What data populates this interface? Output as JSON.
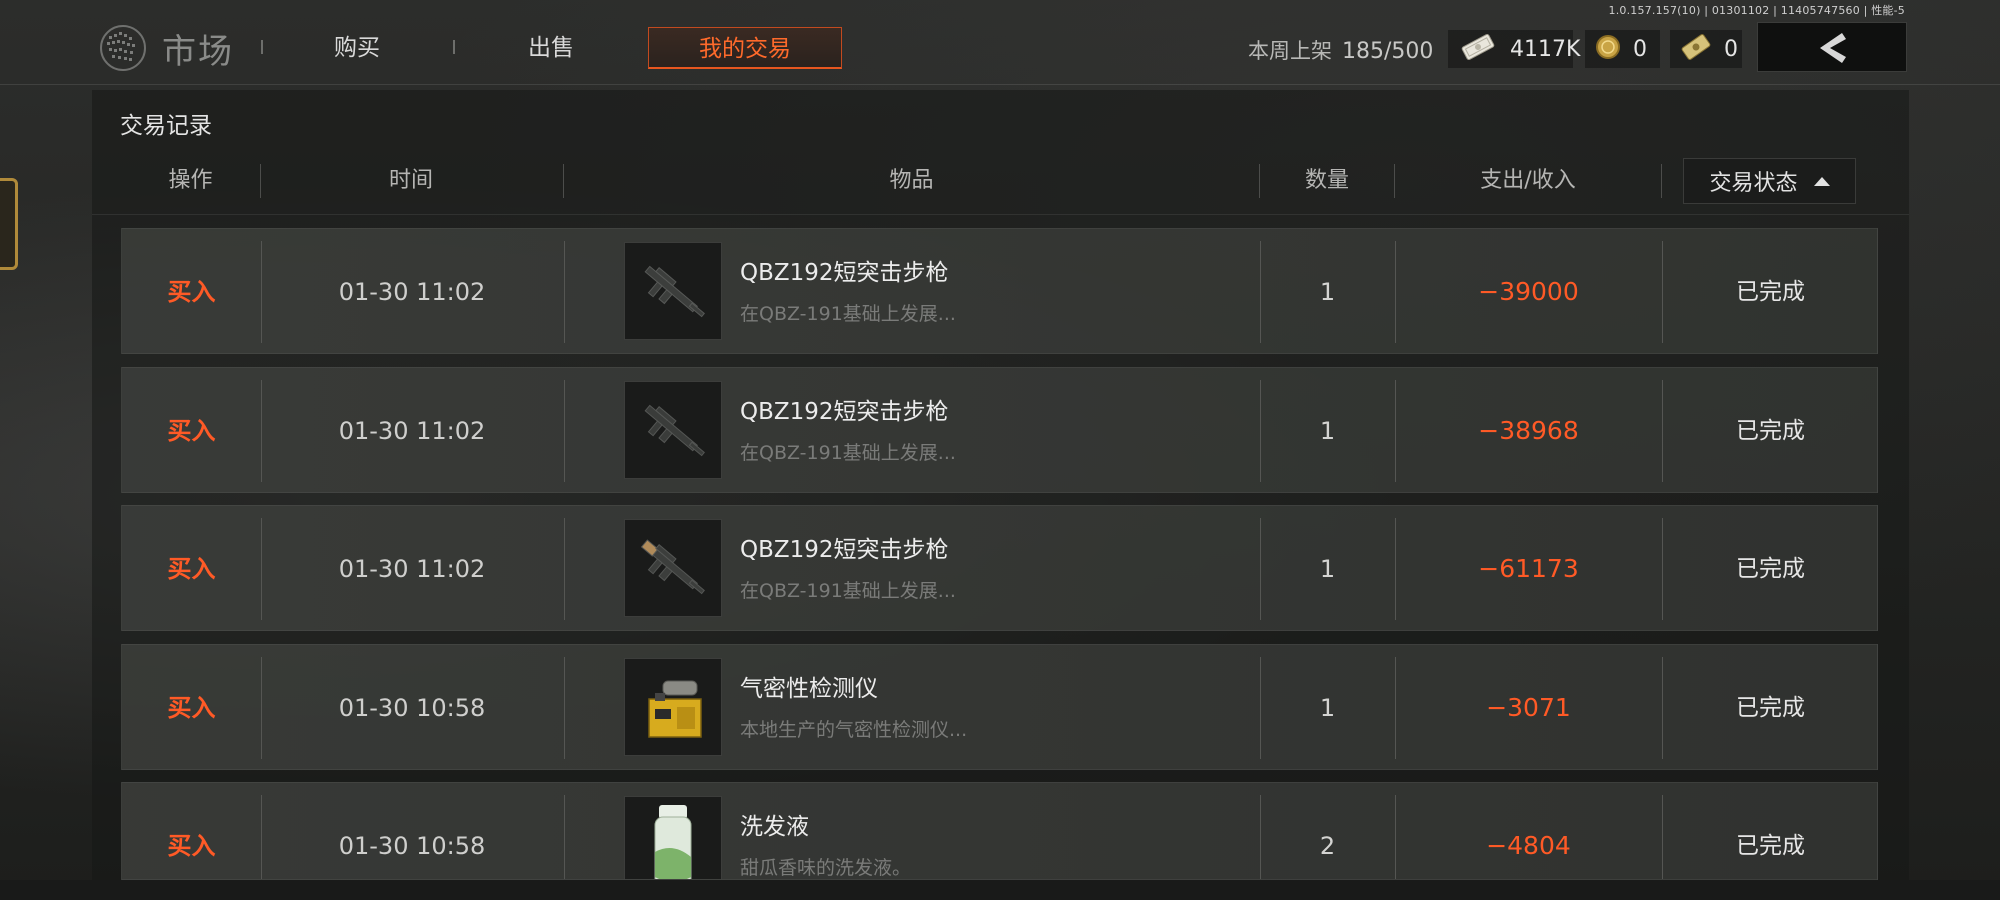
{
  "version_text": "1.0.157.157(10) | 01301102 | 11405747560 | 性能-5",
  "header": {
    "title": "市场",
    "tabs": [
      {
        "label": "购买",
        "active": false
      },
      {
        "label": "出售",
        "active": false
      },
      {
        "label": "我的交易",
        "active": true
      }
    ],
    "weekly_label": "本周上架",
    "weekly_value": "185/500",
    "currencies": [
      {
        "icon": "cash-bundle-icon",
        "value": "4117K"
      },
      {
        "icon": "gold-coin-icon",
        "value": "0"
      },
      {
        "icon": "banknote-icon",
        "value": "0"
      }
    ],
    "back_icon": "chevron-left-icon"
  },
  "panel": {
    "title": "交易记录",
    "columns": {
      "action": "操作",
      "time": "时间",
      "item": "物品",
      "qty": "数量",
      "amount": "支出/收入",
      "status": "交易状态"
    },
    "status_sort_direction": "ascending"
  },
  "rows": [
    {
      "action": "买入",
      "time": "01-30 11:02",
      "name": "QBZ192短突击步枪",
      "desc": "在QBZ-191基础上发展...",
      "qty": "1",
      "amount": "−39000",
      "status": "已完成",
      "icon": "rifle-icon"
    },
    {
      "action": "买入",
      "time": "01-30 11:02",
      "name": "QBZ192短突击步枪",
      "desc": "在QBZ-191基础上发展...",
      "qty": "1",
      "amount": "−38968",
      "status": "已完成",
      "icon": "rifle-icon"
    },
    {
      "action": "买入",
      "time": "01-30 11:02",
      "name": "QBZ192短突击步枪",
      "desc": "在QBZ-191基础上发展...",
      "qty": "1",
      "amount": "−61173",
      "status": "已完成",
      "icon": "rifle-icon"
    },
    {
      "action": "买入",
      "time": "01-30 10:58",
      "name": "气密性检测仪",
      "desc": "本地生产的气密性检测仪...",
      "qty": "1",
      "amount": "−3071",
      "status": "已完成",
      "icon": "detector-icon"
    },
    {
      "action": "买入",
      "time": "01-30 10:58",
      "name": "洗发液",
      "desc": "甜瓜香味的洗发液。",
      "qty": "2",
      "amount": "−4804",
      "status": "已完成",
      "icon": "shampoo-bottle-icon"
    }
  ],
  "colors": {
    "accent": "#ff5a26",
    "active_tab_border": "#e8561f",
    "row_bg": "#383a37"
  }
}
